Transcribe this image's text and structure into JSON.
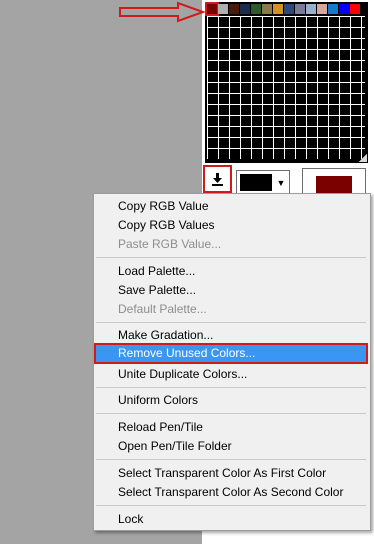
{
  "palette": {
    "swatches": [
      "#7b0000",
      "#b0b0b0",
      "#4a1a0a",
      "#1c2c4c",
      "#2c5a2a",
      "#8a7a4a",
      "#d4902a",
      "#2a4a7c",
      "#7a7a9a",
      "#9ab0c8",
      "#d4a8a0",
      "#1a7ac8",
      "#0000ff",
      "#ff0000",
      "#ff00ff",
      "#ffffff"
    ]
  },
  "color_boxes": {
    "primary": "#000000",
    "secondary": "#7b0000"
  },
  "menu": {
    "items": [
      {
        "label": "Copy RGB Value",
        "enabled": true
      },
      {
        "label": "Copy RGB Values",
        "enabled": true
      },
      {
        "label": "Paste RGB Value...",
        "enabled": false
      },
      {
        "label": "Load Palette...",
        "enabled": true
      },
      {
        "label": "Save Palette...",
        "enabled": true
      },
      {
        "label": "Default Palette...",
        "enabled": false
      },
      {
        "label": "Make Gradation...",
        "enabled": true
      },
      {
        "label": "Remove Unused Colors...",
        "enabled": true,
        "highlighted": true
      },
      {
        "label": "Unite Duplicate Colors...",
        "enabled": true
      },
      {
        "label": "Uniform Colors",
        "enabled": true
      },
      {
        "label": "Reload Pen/Tile",
        "enabled": true
      },
      {
        "label": "Open Pen/Tile Folder",
        "enabled": true
      },
      {
        "label": "Select Transparent Color As First Color",
        "enabled": true
      },
      {
        "label": "Select Transparent Color As Second Color",
        "enabled": true
      },
      {
        "label": "Lock",
        "enabled": true
      }
    ]
  },
  "annotation_color": "#d11a1a"
}
